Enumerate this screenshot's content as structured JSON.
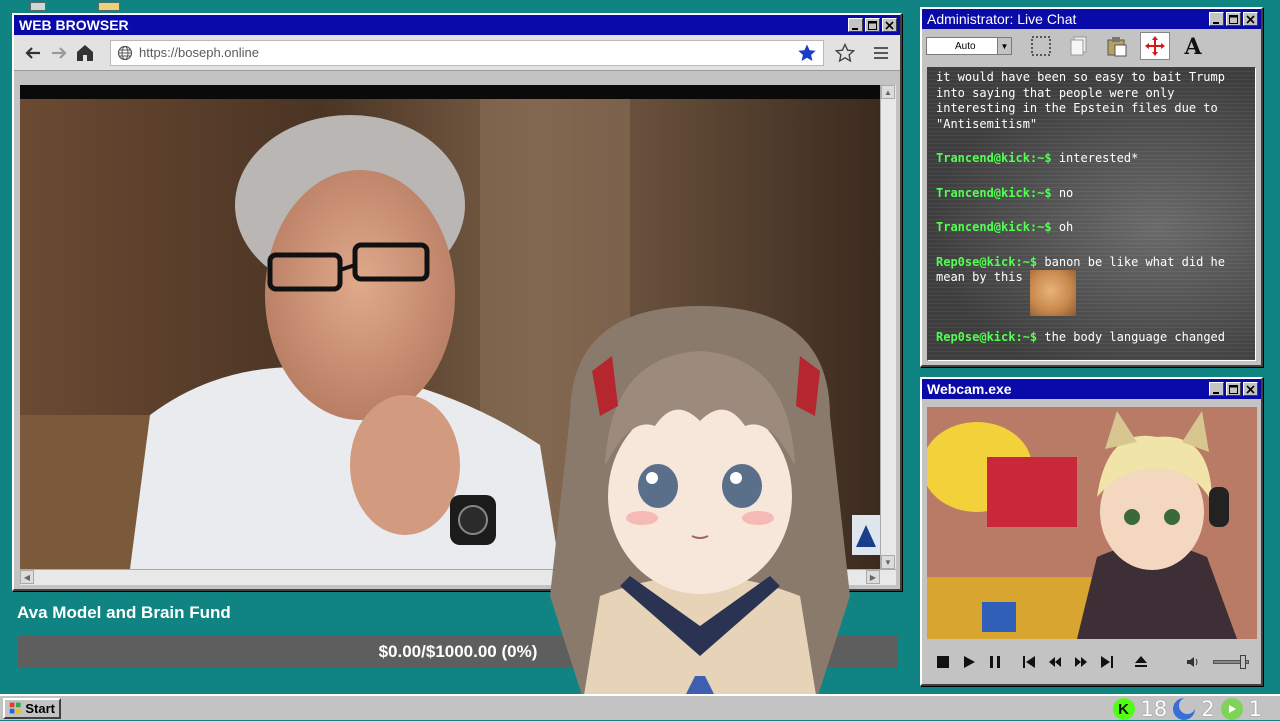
{
  "browser": {
    "title": "WEB BROWSER",
    "url": "https://boseph.online"
  },
  "fund": {
    "title": "Ava Model and Brain Fund",
    "progress_text": "$0.00/$1000.00 (0%)",
    "progress_fraction": 0.0
  },
  "chat": {
    "title": "Administrator: Live Chat",
    "size_select": "Auto",
    "messages": [
      {
        "user": "",
        "text": "it would have been so easy to bait Trump into saying that people were only interesting in the Epstein files due to \"Antisemitism\""
      },
      {
        "user": "Trancend@kick:~$",
        "text": "interested*"
      },
      {
        "user": "Trancend@kick:~$",
        "text": "no"
      },
      {
        "user": "Trancend@kick:~$",
        "text": "oh"
      },
      {
        "user": "Rep0se@kick:~$",
        "text": "banon be like what did he mean by this"
      },
      {
        "user": "Rep0se@kick:~$",
        "text": "the body language changed"
      }
    ]
  },
  "webcam": {
    "title": "Webcam.exe"
  },
  "taskbar": {
    "start_label": "Start",
    "tray": [
      {
        "icon": "kick-icon",
        "value": "18",
        "color": "#53fc18"
      },
      {
        "icon": "moon-icon",
        "value": "2",
        "color": "#3a6fd8"
      },
      {
        "icon": "play-icon",
        "value": "1",
        "color": "#7fd35a"
      }
    ]
  },
  "colors": {
    "desktop": "#0f8482",
    "titlebar": "#0a0aa8",
    "chat_user": "#51ff51",
    "fund_bar": "#5e5e5e"
  }
}
